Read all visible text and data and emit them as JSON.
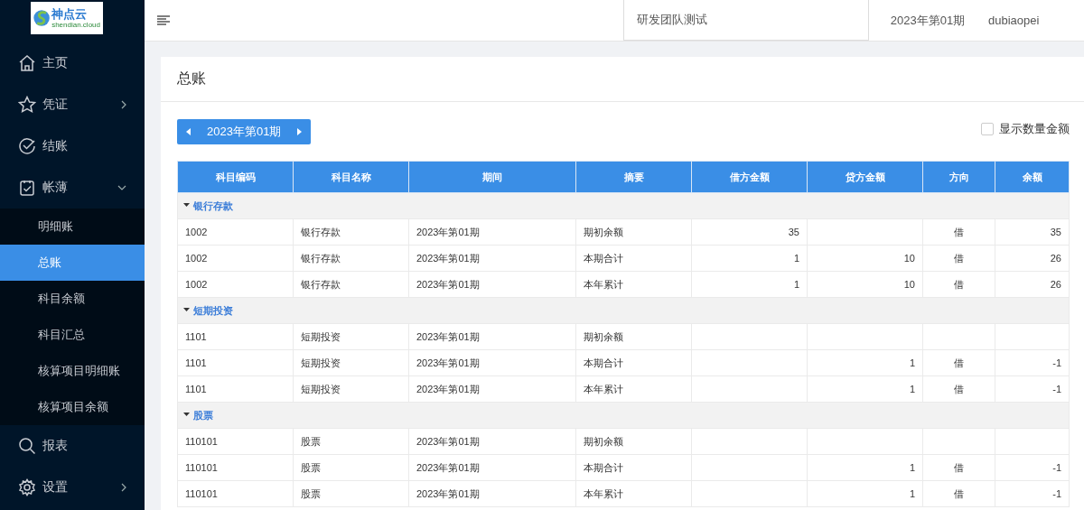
{
  "logo": {
    "name": "神点云",
    "domain": "shendian.cloud"
  },
  "sidebar": {
    "items": [
      {
        "label": "主页"
      },
      {
        "label": "凭证",
        "expanded": false
      },
      {
        "label": "结账"
      },
      {
        "label": "帐薄",
        "expanded": true,
        "children": [
          {
            "label": "明细账",
            "selected": false
          },
          {
            "label": "总账",
            "selected": true
          },
          {
            "label": "科目余额",
            "selected": false
          },
          {
            "label": "科目汇总",
            "selected": false
          },
          {
            "label": "核算项目明细账",
            "selected": false
          },
          {
            "label": "核算项目余额",
            "selected": false
          }
        ]
      },
      {
        "label": "报表"
      },
      {
        "label": "设置",
        "expanded": false
      }
    ]
  },
  "header": {
    "team": "研发团队测试",
    "period": "2023年第01期",
    "user": "dubiaopei"
  },
  "page": {
    "title": "总账",
    "period_picker": "2023年第01期",
    "show_quantity": {
      "label": "显示数量金额",
      "checked": false
    }
  },
  "table": {
    "columns": [
      "科目编码",
      "科目名称",
      "期间",
      "摘要",
      "借方金额",
      "贷方金额",
      "方向",
      "余额"
    ],
    "groups": [
      {
        "name": "银行存款",
        "expanded": true,
        "rows": [
          {
            "code": "1002",
            "name": "银行存款",
            "period": "2023年第01期",
            "summary": "期初余额",
            "debit": "35",
            "direction": "借",
            "balance": "35"
          },
          {
            "code": "1002",
            "name": "银行存款",
            "period": "2023年第01期",
            "summary": "本期合计",
            "debit": "1",
            "credit": "10",
            "direction": "借",
            "balance": "26"
          },
          {
            "code": "1002",
            "name": "银行存款",
            "period": "2023年第01期",
            "summary": "本年累计",
            "debit": "1",
            "credit": "10",
            "direction": "借",
            "balance": "26"
          }
        ]
      },
      {
        "name": "短期投资",
        "expanded": true,
        "rows": [
          {
            "code": "1101",
            "name": "短期投资",
            "period": "2023年第01期",
            "summary": "期初余额"
          },
          {
            "code": "1101",
            "name": "短期投资",
            "period": "2023年第01期",
            "summary": "本期合计",
            "credit": "1",
            "direction": "借",
            "balance": "-1"
          },
          {
            "code": "1101",
            "name": "短期投资",
            "period": "2023年第01期",
            "summary": "本年累计",
            "credit": "1",
            "direction": "借",
            "balance": "-1"
          }
        ]
      },
      {
        "name": "股票",
        "expanded": true,
        "rows": [
          {
            "code": "110101",
            "name": "股票",
            "period": "2023年第01期",
            "summary": "期初余额"
          },
          {
            "code": "110101",
            "name": "股票",
            "period": "2023年第01期",
            "summary": "本期合计",
            "credit": "1",
            "direction": "借",
            "balance": "-1"
          },
          {
            "code": "110101",
            "name": "股票",
            "period": "2023年第01期",
            "summary": "本年累计",
            "credit": "1",
            "direction": "借",
            "balance": "-1"
          }
        ]
      }
    ]
  }
}
